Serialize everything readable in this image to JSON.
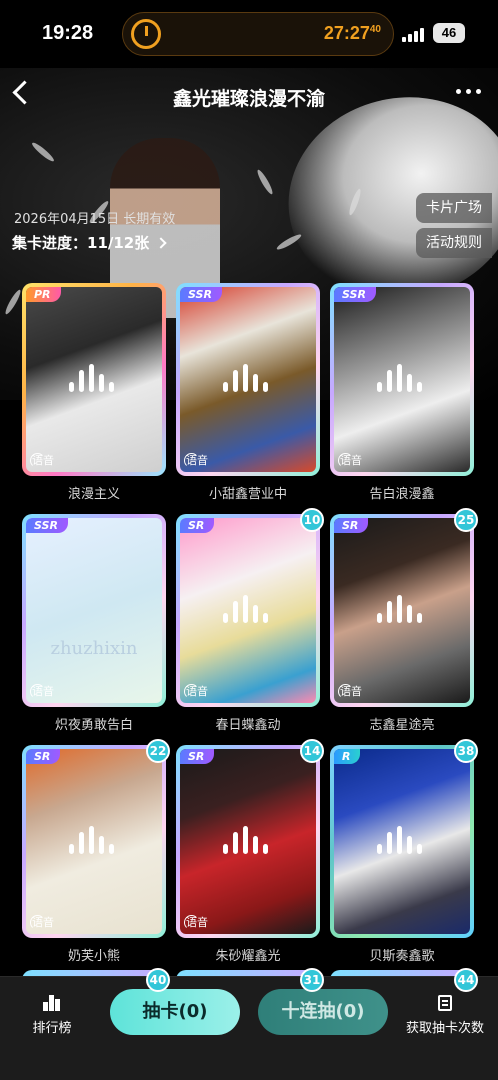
{
  "status_bar": {
    "time": "19:28",
    "countdown": "27:27",
    "countdown_fraction": "40",
    "battery": "46",
    "accent_color": "#f0a020"
  },
  "header": {
    "title": "鑫光璀璨浪漫不渝",
    "date_line": "2026年04月15日 长期有效",
    "progress_label": "集卡进度：11/12张",
    "card_plaza_label": "卡片广场",
    "rules_label": "活动规则"
  },
  "cards": [
    {
      "rarity": "PR",
      "name": "浪漫主义",
      "count": "",
      "voice": "语音"
    },
    {
      "rarity": "SSR",
      "name": "小甜鑫营业中",
      "count": "",
      "voice": "语音"
    },
    {
      "rarity": "SSR",
      "name": "告白浪漫鑫",
      "count": "",
      "voice": "语音"
    },
    {
      "rarity": "SSR",
      "name": "炽夜勇敢告白",
      "count": "",
      "voice": "语音",
      "card_text": "zhuzhixin"
    },
    {
      "rarity": "SR",
      "name": "春日蝶鑫动",
      "count": "10",
      "voice": "语音"
    },
    {
      "rarity": "SR",
      "name": "志鑫星途亮",
      "count": "25",
      "voice": "语音"
    },
    {
      "rarity": "SR",
      "name": "奶芙小熊",
      "count": "22",
      "voice": "语音"
    },
    {
      "rarity": "SR",
      "name": "朱砂耀鑫光",
      "count": "14",
      "voice": "语音"
    },
    {
      "rarity": "R",
      "name": "贝斯奏鑫歌",
      "count": "38",
      "voice": "语音"
    }
  ],
  "peek_counts": [
    "40",
    "31",
    "44"
  ],
  "bottom_bar": {
    "rank_label": "排行榜",
    "draw_label": "抽卡(0)",
    "ten_draw_label": "十连抽(0)",
    "get_times_label": "获取抽卡次数"
  },
  "colors": {
    "draw_button": "#5ee3d9",
    "ten_draw_button": "#2f7f79",
    "count_badge": "#32c6d8"
  }
}
